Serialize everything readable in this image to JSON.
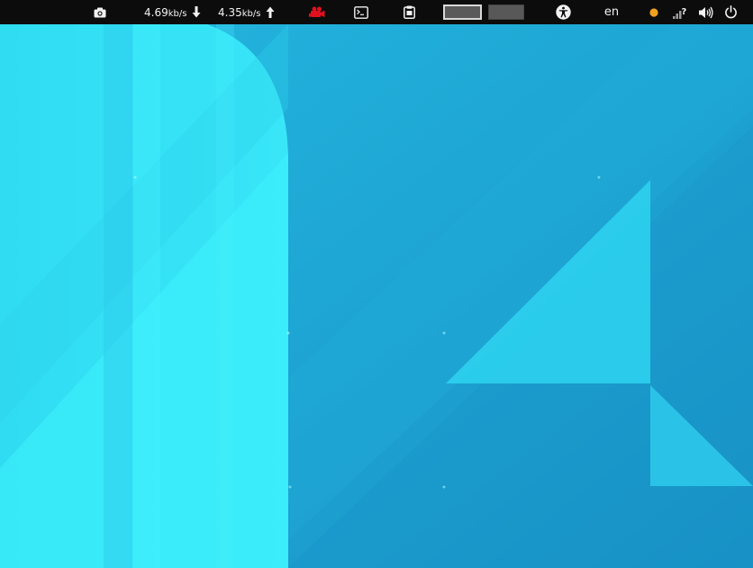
{
  "topbar": {
    "screenshot_icon": "camera-icon",
    "download_speed": {
      "value": "4.69",
      "unit": "kb/s",
      "icon": "arrow-down-icon"
    },
    "upload_speed": {
      "value": "4.35",
      "unit": "kb/s",
      "icon": "arrow-up-icon"
    },
    "recorder_icon": "video-camera-icon",
    "terminal_icon": "terminal-icon",
    "clipboard_icon": "clipboard-icon",
    "workspaces": [
      {
        "name": "workspace-1",
        "active": true
      },
      {
        "name": "workspace-2",
        "active": false
      }
    ],
    "accessibility_icon": "accessibility-icon",
    "language": "en",
    "status_dot_color": "#f0a020",
    "network_icon": "network-unknown-icon",
    "volume_icon": "volume-icon",
    "power_icon": "power-icon"
  },
  "colors": {
    "topbar_bg": "#0c0c0c",
    "wallpaper_base": "#1fa6d3",
    "wallpaper_light": "#36e8f8",
    "recorder_red": "#e0101e"
  }
}
